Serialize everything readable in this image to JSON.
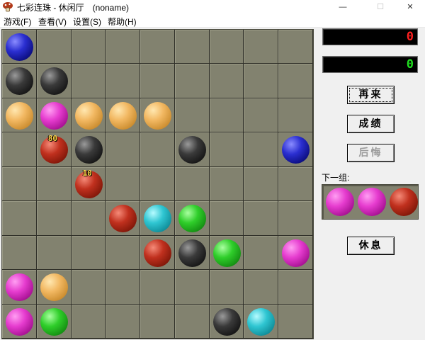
{
  "window": {
    "title": "七彩连珠 - 休闲厅　(noname)",
    "minimize_glyph": "—",
    "maximize_glyph": "☐",
    "close_glyph": "✕",
    "icon": "mushroom-icon"
  },
  "menu": [
    "游戏(F)",
    "查看(V)",
    "设置(S)",
    "帮助(H)"
  ],
  "scores": {
    "top": "0",
    "current": "0"
  },
  "buttons": {
    "restart": "再来",
    "scores": "成绩",
    "undo": "后悔",
    "pause": "休息"
  },
  "next_label": "下一组:",
  "next_balls": [
    "magenta",
    "magenta",
    "red"
  ],
  "board": {
    "rows": 9,
    "cols": 9,
    "colors": {
      "blue": "#2a2ed0",
      "black": "#1e1e1e",
      "orange": "#f2b862",
      "magenta": "#e63ccf",
      "red": "#c0301e",
      "cyan": "#2fc6d2",
      "green": "#2fce2a",
      "board_bg": "#82826f"
    },
    "balls": [
      {
        "row": 0,
        "col": 0,
        "color": "blue"
      },
      {
        "row": 1,
        "col": 0,
        "color": "black"
      },
      {
        "row": 1,
        "col": 1,
        "color": "black"
      },
      {
        "row": 2,
        "col": 0,
        "color": "orange"
      },
      {
        "row": 2,
        "col": 1,
        "color": "magenta"
      },
      {
        "row": 2,
        "col": 2,
        "color": "orange"
      },
      {
        "row": 2,
        "col": 3,
        "color": "orange"
      },
      {
        "row": 2,
        "col": 4,
        "color": "orange"
      },
      {
        "row": 3,
        "col": 1,
        "color": "red"
      },
      {
        "row": 3,
        "col": 2,
        "color": "black"
      },
      {
        "row": 3,
        "col": 5,
        "color": "black"
      },
      {
        "row": 3,
        "col": 8,
        "color": "blue"
      },
      {
        "row": 4,
        "col": 2,
        "color": "red"
      },
      {
        "row": 5,
        "col": 3,
        "color": "red"
      },
      {
        "row": 5,
        "col": 4,
        "color": "cyan"
      },
      {
        "row": 5,
        "col": 5,
        "color": "green"
      },
      {
        "row": 6,
        "col": 4,
        "color": "red"
      },
      {
        "row": 6,
        "col": 5,
        "color": "black"
      },
      {
        "row": 6,
        "col": 6,
        "color": "green"
      },
      {
        "row": 6,
        "col": 8,
        "color": "magenta"
      },
      {
        "row": 7,
        "col": 0,
        "color": "magenta"
      },
      {
        "row": 7,
        "col": 1,
        "color": "orange"
      },
      {
        "row": 8,
        "col": 0,
        "color": "magenta"
      },
      {
        "row": 8,
        "col": 1,
        "color": "green"
      },
      {
        "row": 8,
        "col": 6,
        "color": "black"
      },
      {
        "row": 8,
        "col": 7,
        "color": "cyan"
      }
    ],
    "point_popups": [
      {
        "row": 3,
        "col": 1,
        "text": "80"
      },
      {
        "row": 4,
        "col": 2,
        "text": "10"
      }
    ]
  }
}
